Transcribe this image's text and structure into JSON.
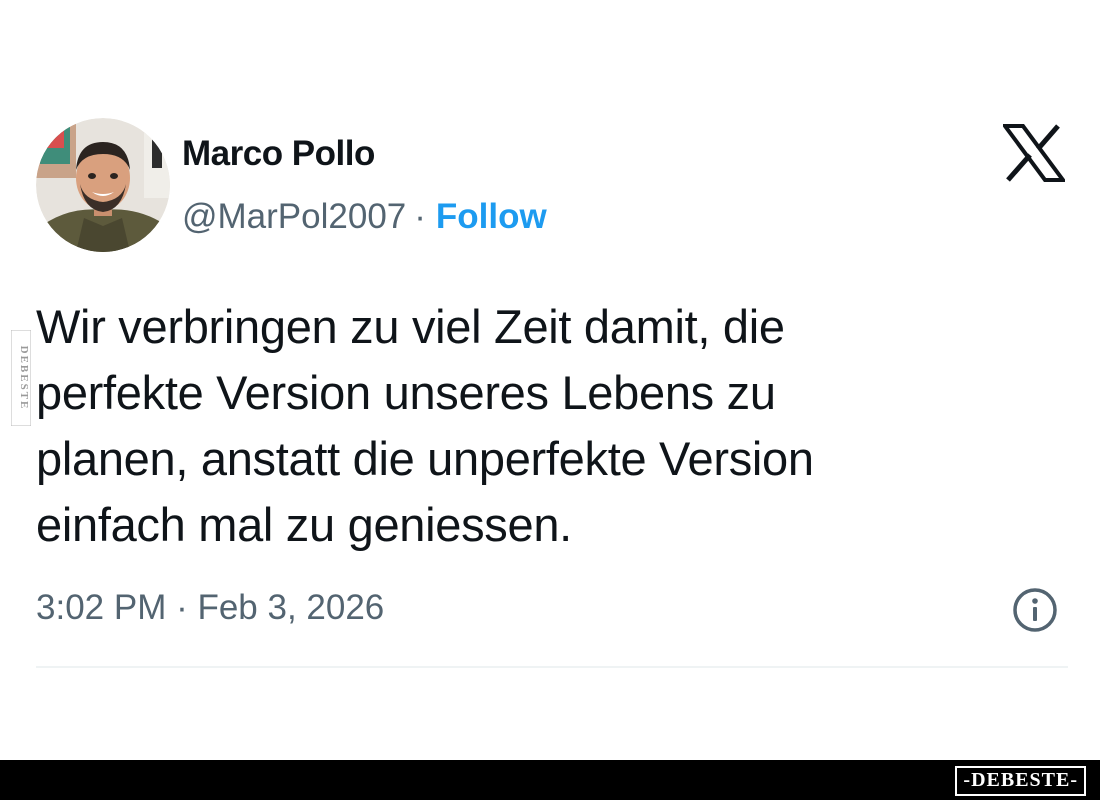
{
  "tweet": {
    "author": {
      "display_name": "Marco Pollo",
      "handle": "@MarPol2007",
      "separator": "·",
      "follow_label": "Follow"
    },
    "brand_icon": "x-logo-icon",
    "text_lines": [
      "Wir verbringen zu viel Zeit damit, die",
      "perfekte Version unseres Lebens zu",
      "planen, anstatt die unperfekte Version",
      "einfach mal zu geniessen."
    ],
    "timestamp": "3:02 PM · Feb 3, 2026",
    "info_icon": "info-icon"
  },
  "watermark": {
    "side_text": "DEBESTE",
    "footer_text": "-DEBESTE-"
  },
  "colors": {
    "text_primary": "#0f1419",
    "text_secondary": "#536471",
    "follow_blue": "#1d9bf0",
    "divider": "#eff3f4",
    "footer_bg": "#000000"
  }
}
